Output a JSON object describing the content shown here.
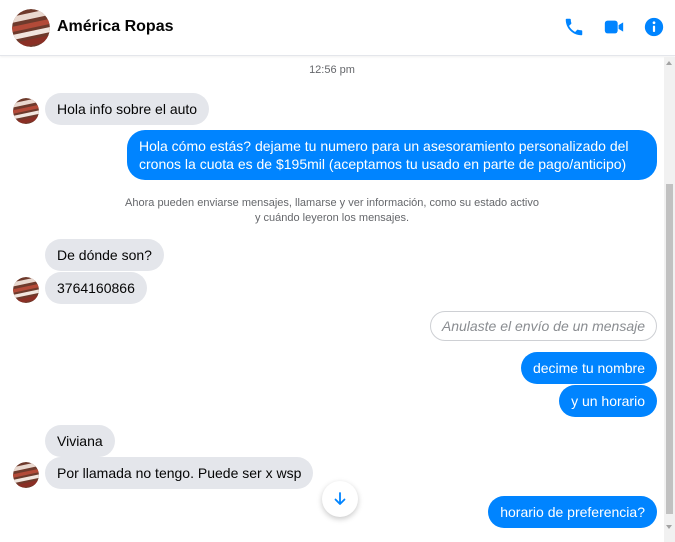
{
  "header": {
    "title": "América Ropas",
    "actions": {
      "call_icon": "phone-icon",
      "video_icon": "video-camera-icon",
      "info_icon": "info-icon"
    }
  },
  "colors": {
    "accent": "#0084ff",
    "incoming_bubble": "#e4e6eb",
    "meta_text": "#65676b"
  },
  "chat": {
    "timestamp": "12:56 pm",
    "messages": [
      {
        "dir": "in",
        "text": "Hola info sobre el auto"
      },
      {
        "dir": "out",
        "text": "Hola cómo estás? dejame tu numero para un asesoramiento personalizado del cronos la cuota es de $195mil (aceptamos tu usado en parte de pago/anticipo)"
      },
      {
        "dir": "in",
        "text": "De dónde son?"
      },
      {
        "dir": "in",
        "text": "3764160866"
      },
      {
        "dir": "out",
        "text": "Anulaste el envío de un mensaje"
      },
      {
        "dir": "out",
        "text": "decime tu nombre"
      },
      {
        "dir": "out",
        "text": "y un horario"
      },
      {
        "dir": "in",
        "text": "Viviana"
      },
      {
        "dir": "in",
        "text": "Por llamada no tengo. Puede ser x wsp"
      },
      {
        "dir": "out",
        "text": "horario de preferencia?"
      }
    ],
    "system_notice": {
      "line1": "Ahora pueden enviarse mensajes, llamarse y ver información, como su estado activo",
      "line2": "y cuándo leyeron los mensajes."
    },
    "scroll_to_bottom_icon": "arrow-down-icon"
  }
}
